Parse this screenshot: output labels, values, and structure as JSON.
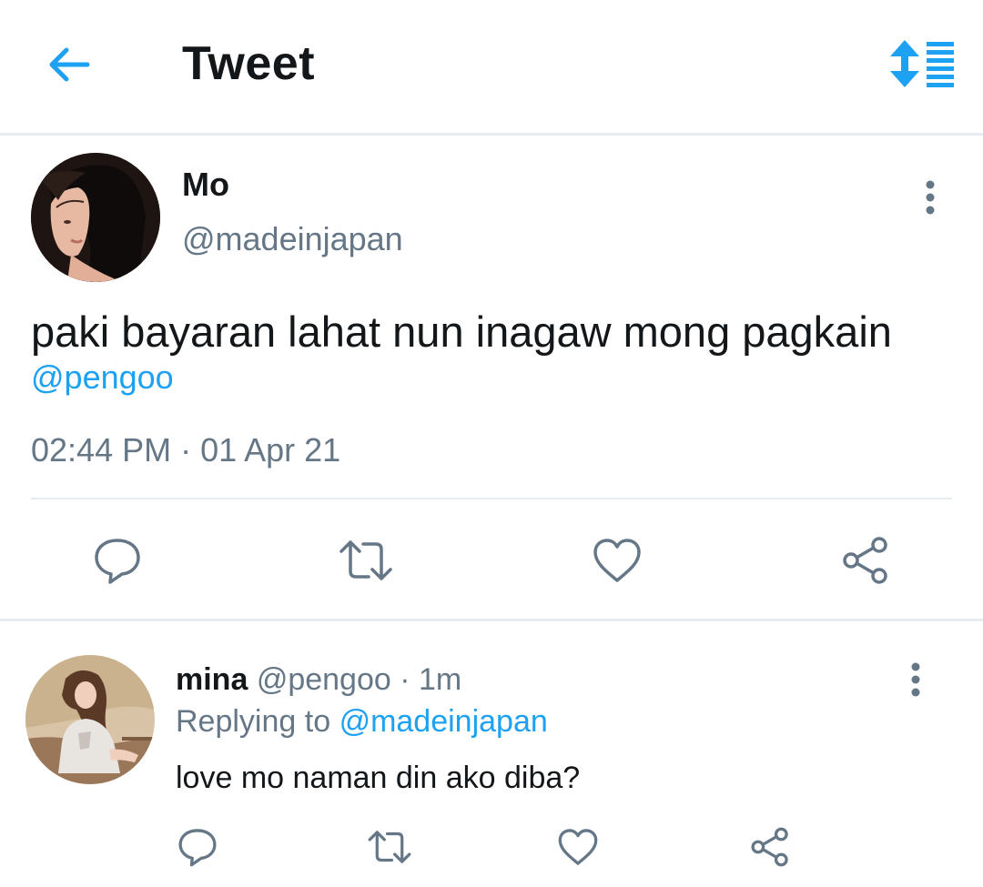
{
  "header": {
    "title": "Tweet",
    "back_icon": "arrow-left-icon",
    "sort_icon": "sort-arrows-icon"
  },
  "colors": {
    "accent": "#1da1f2",
    "secondary_text": "#657786",
    "divider": "#e6ecf0",
    "icon_gray": "#657786"
  },
  "tweet": {
    "name": "Mo",
    "handle": "@madeinjapan",
    "text": "paki bayaran lahat nun inagaw mong pagkain",
    "mention": "@pengoo",
    "timestamp": "02:44 PM · 01 Apr 21",
    "actions": [
      "reply-icon",
      "retweet-icon",
      "like-icon",
      "share-icon"
    ]
  },
  "reply": {
    "name": "mina",
    "handle": "@pengoo",
    "time": "· 1m",
    "replying_label": "Replying to",
    "replying_to": "@madeinjapan",
    "text": "love mo naman din ako diba?",
    "actions": [
      "reply-icon",
      "retweet-icon",
      "like-icon",
      "share-icon"
    ]
  }
}
